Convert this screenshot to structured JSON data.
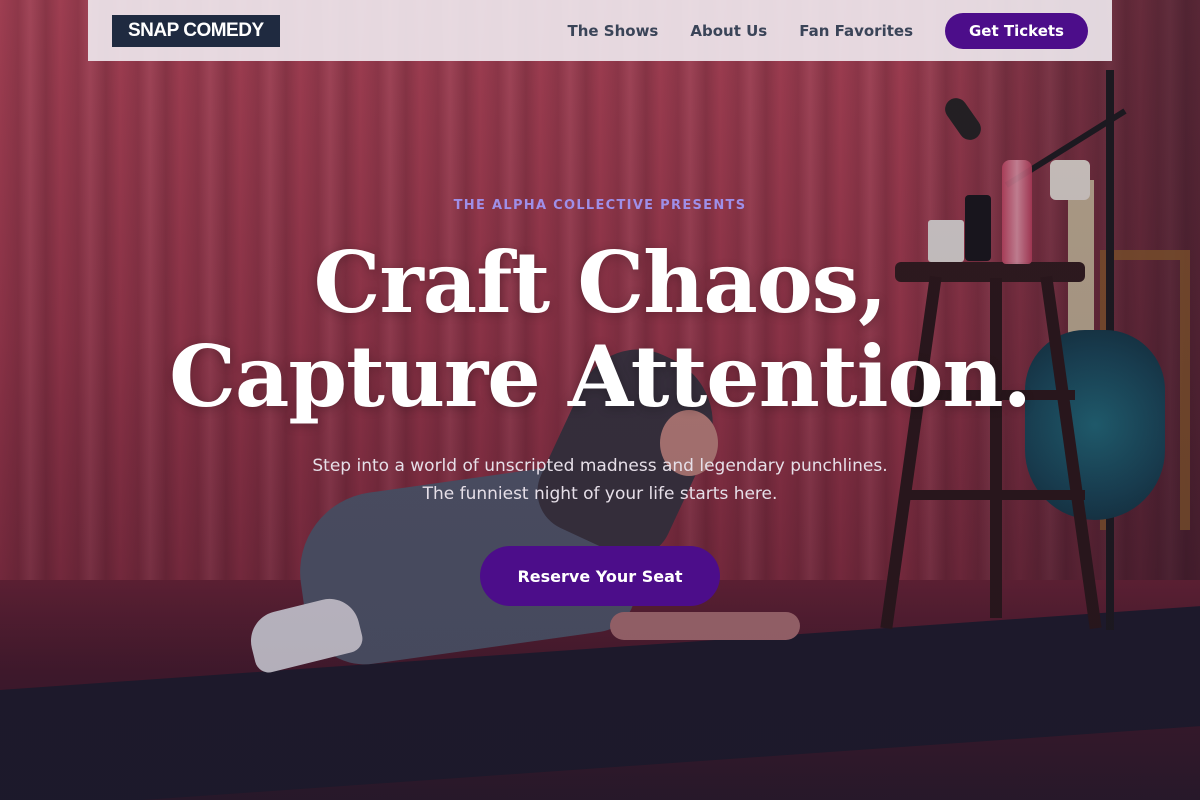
{
  "navbar": {
    "logo": "SNAP COMEDY",
    "links": [
      "The Shows",
      "About Us",
      "Fan Favorites"
    ],
    "cta_label": "Get Tickets"
  },
  "hero": {
    "eyebrow": "THE ALPHA COLLECTIVE PRESENTS",
    "headline_line1": "Craft Chaos,",
    "headline_line2": "Capture Attention.",
    "subhead_line1": "Step into a world of unscripted madness and legendary punchlines.",
    "subhead_line2": "The funniest night of your life starts here.",
    "cta_label": "Reserve Your Seat"
  },
  "colors": {
    "accent": "#4c0d8a",
    "eyebrow": "#9f8fe8",
    "logo_bg": "#1f2a40"
  }
}
